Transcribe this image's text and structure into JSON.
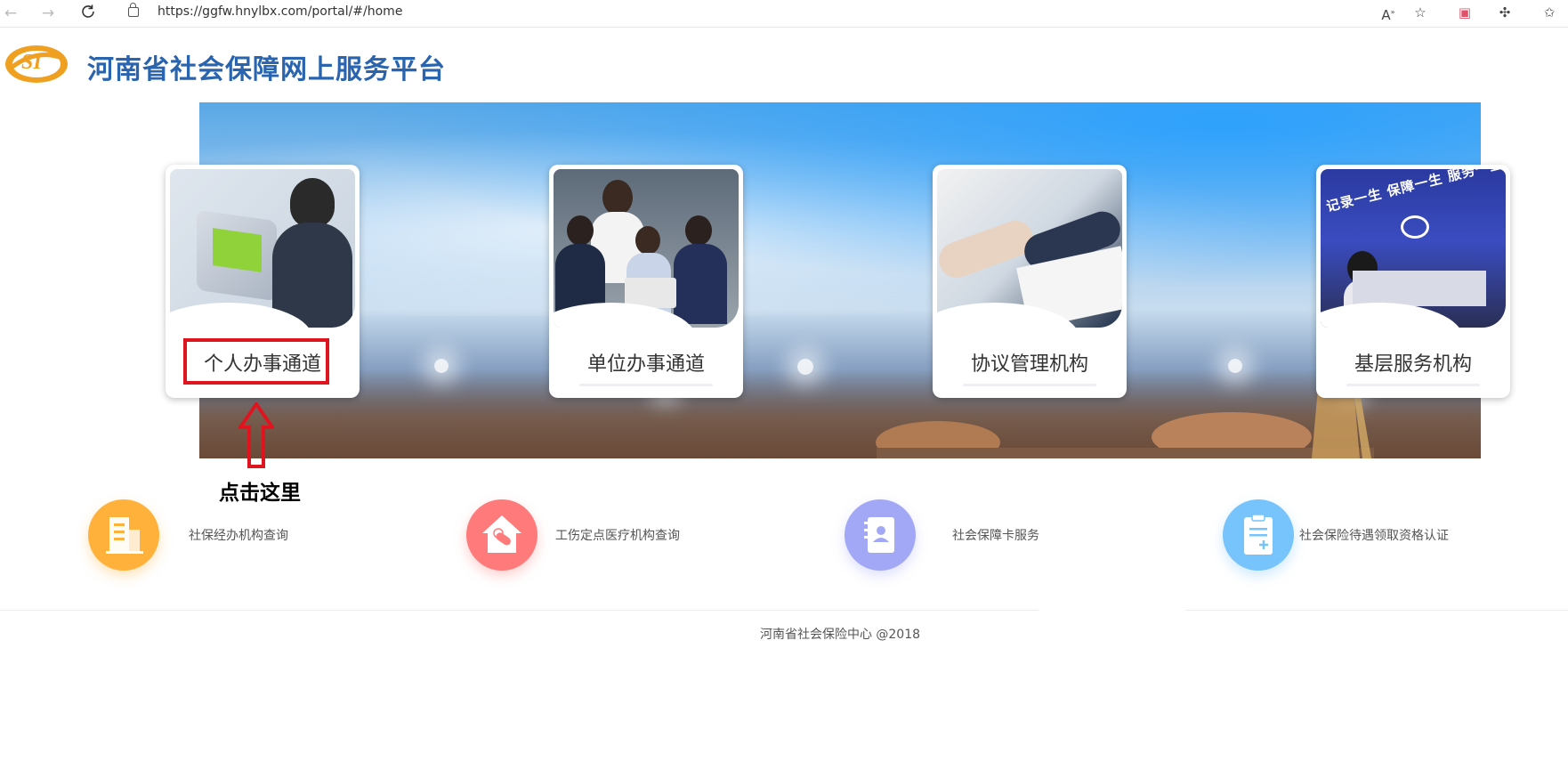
{
  "browser": {
    "url": "https://ggfw.hnylbx.com/portal/#/home",
    "icons": [
      "back-icon",
      "forward-icon",
      "reload-icon",
      "lock-icon",
      "read-aloud-icon",
      "favorite-add-icon",
      "collections-icon",
      "extensions-icon",
      "favorites-icon"
    ]
  },
  "site": {
    "title": "河南省社会保障网上服务平台",
    "logo_text": "SI"
  },
  "channels": [
    {
      "label": "个人办事通道",
      "icon": "person-at-kiosk-photo"
    },
    {
      "label": "单位办事通道",
      "icon": "team-photo"
    },
    {
      "label": "协议管理机构",
      "icon": "handshake-photo"
    },
    {
      "label": "基层服务机构",
      "icon": "service-hall-photo"
    }
  ],
  "banner_sign": "记录一生 保障一生 服务一生",
  "annotation": {
    "hint": "点击这里",
    "color": "#e0141e"
  },
  "services": [
    {
      "label": "社保经办机构查询",
      "icon": "building-icon",
      "color": "#ffb13c"
    },
    {
      "label": "工伤定点医疗机构查询",
      "icon": "medical-house-icon",
      "color": "#ff7b7b"
    },
    {
      "label": "社会保障卡服务",
      "icon": "card-book-icon",
      "color": "#a3a8f6"
    },
    {
      "label": "社会保险待遇领取资格认证",
      "icon": "clipboard-icon",
      "color": "#77c3fb"
    }
  ],
  "footer": {
    "copyright": "河南省社会保险中心 @2018"
  },
  "colors": {
    "title_blue": "#2a64ae",
    "logo_orange": "#f0a020"
  }
}
